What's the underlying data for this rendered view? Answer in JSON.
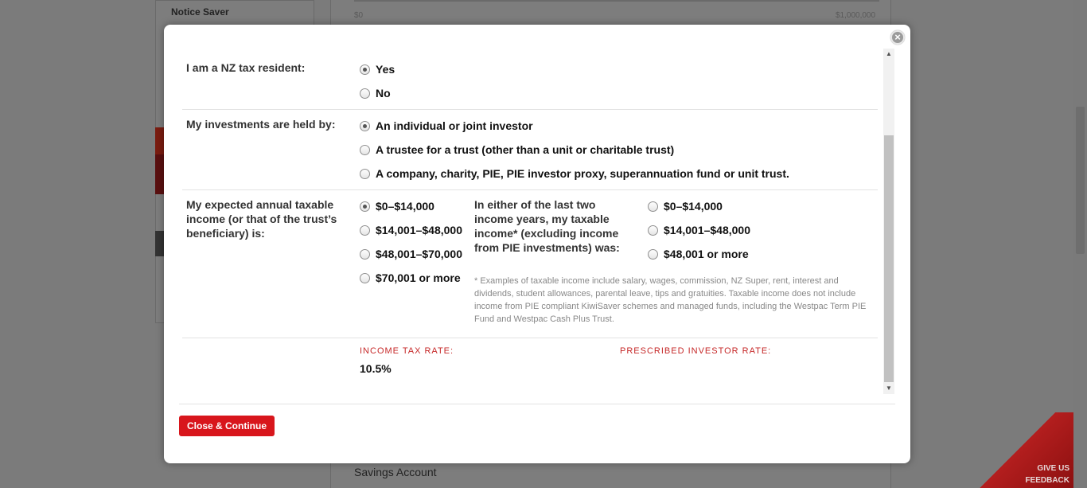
{
  "background": {
    "sidebar_notice": "Notice Saver",
    "slider_min": "$0",
    "slider_max": "$1,000,000",
    "savings_label": "Savings Account",
    "feedback_line1": "GIVE US",
    "feedback_line2": "FEEDBACK"
  },
  "modal": {
    "close_icon": "×",
    "tax_resident": {
      "label": "I am a NZ tax resident:",
      "options": [
        "Yes",
        "No"
      ],
      "selected": "Yes"
    },
    "investments": {
      "label": "My investments are held by:",
      "options": [
        "An individual or joint investor",
        "A trustee for a trust (other than a unit or charitable trust)",
        "A company, charity, PIE, PIE investor proxy, superannuation fund or unit trust."
      ],
      "selected": "An individual or joint investor"
    },
    "income": {
      "label": "My expected annual taxable income (or that of the trust’s beneficiary) is:",
      "options": [
        "$0–$14,000",
        "$14,001–$48,000",
        "$48,001–$70,000",
        "$70,001 or more"
      ],
      "selected": "$0–$14,000",
      "past_label": "In either of the last two income years, my taxable income* (excluding income from PIE investments) was:",
      "past_options": [
        "$0–$14,000",
        "$14,001–$48,000",
        "$48,001 or more"
      ],
      "past_selected": "",
      "footnote": "* Examples of taxable income include salary, wages, commission, NZ Super, rent, interest and dividends, student allowances, parental leave, tips and gratuities. Taxable income does not include income from PIE compliant KiwiSaver schemes and managed funds, including the Westpac Term PIE Fund and Westpac Cash Plus Trust."
    },
    "rates": {
      "income_tax_label": "INCOME TAX RATE:",
      "income_tax_value": "10.5%",
      "pir_label": "PRESCRIBED INVESTOR RATE:",
      "pir_value": ""
    },
    "continue_button": "Close & Continue"
  },
  "colors": {
    "accent_red": "#d8161c",
    "rate_label_red": "#c62828"
  }
}
